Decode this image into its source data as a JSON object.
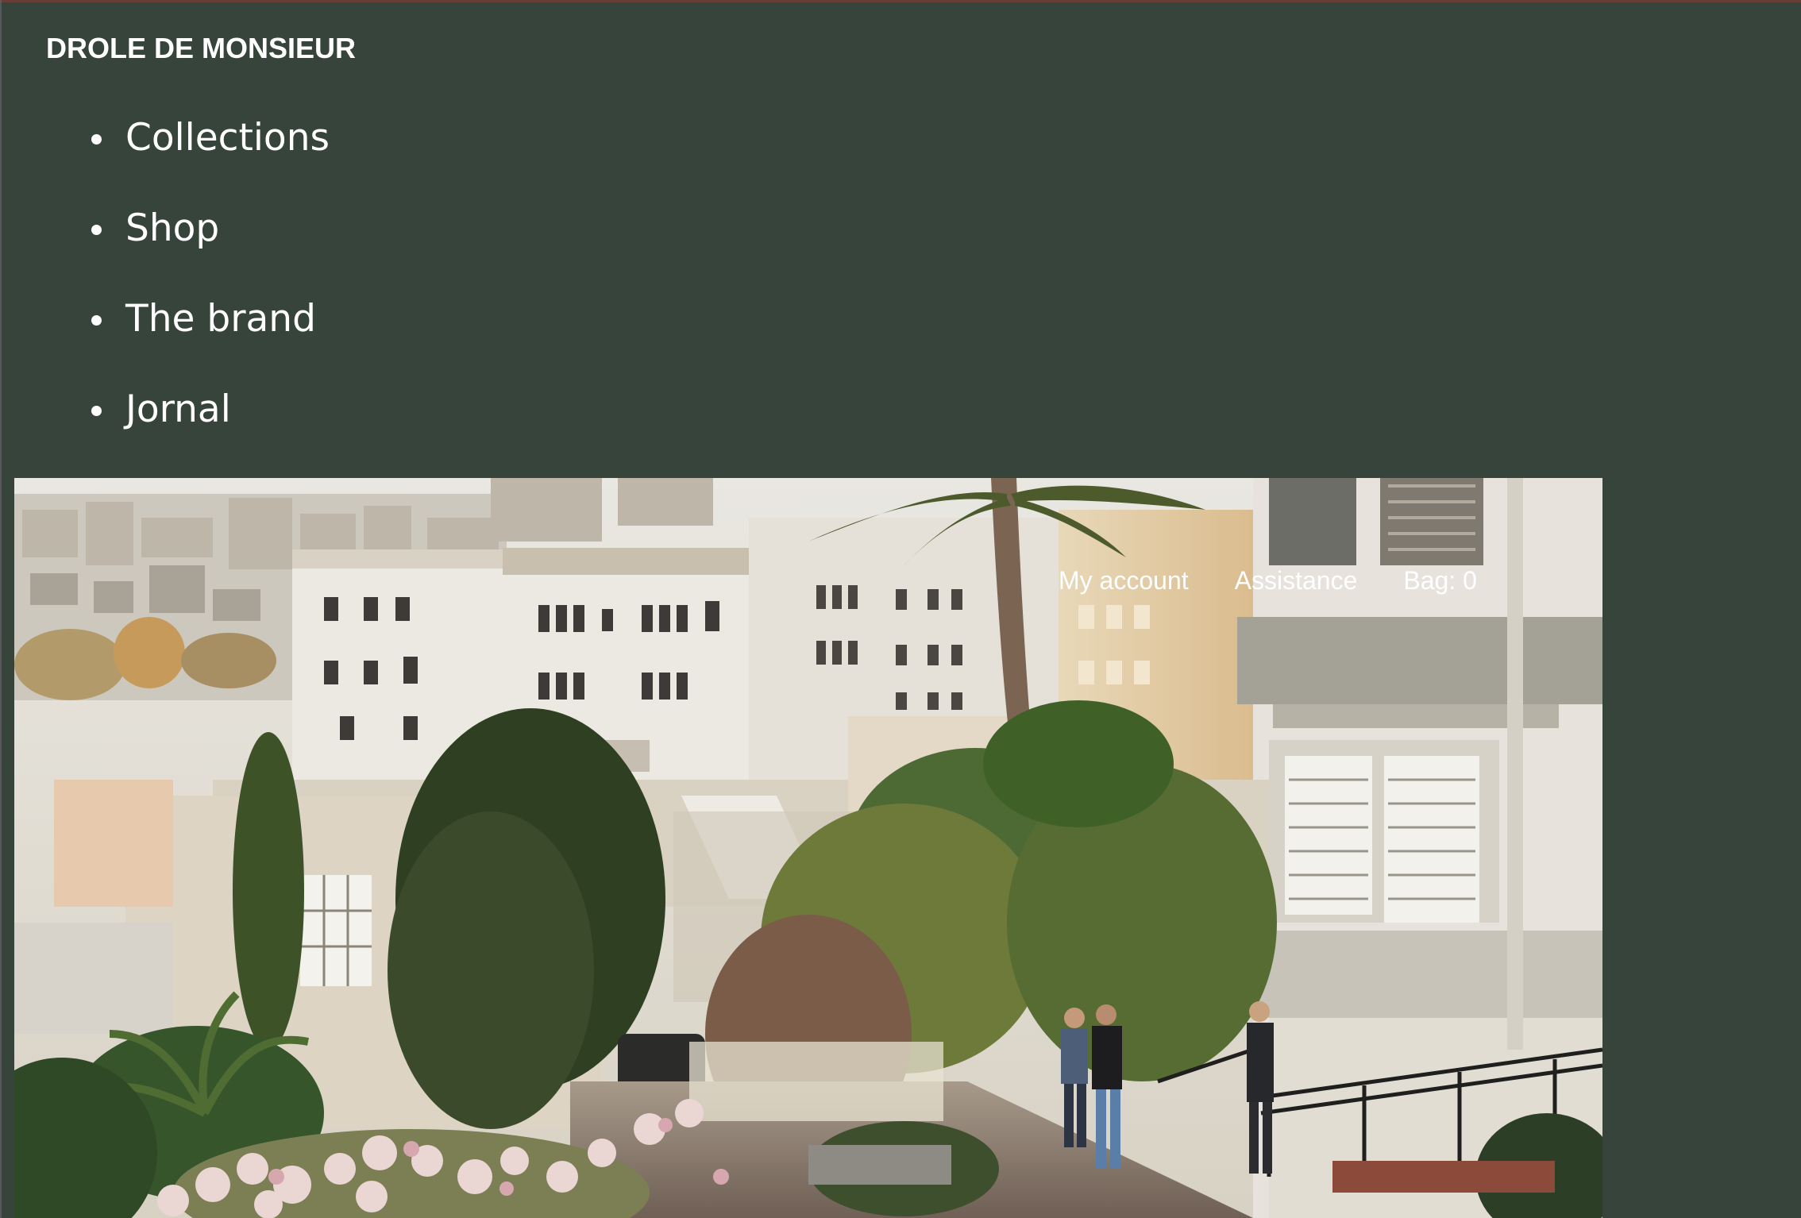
{
  "header": {
    "brand": "DROLE DE MONSIEUR"
  },
  "nav": {
    "items": [
      {
        "label": "Collections"
      },
      {
        "label": "Shop"
      },
      {
        "label": "The brand"
      },
      {
        "label": "Jornal"
      }
    ]
  },
  "utility": {
    "account_label": "My account",
    "assistance_label": "Assistance",
    "bag_label": "Bag: 0"
  },
  "theme": {
    "background": "#37443b",
    "text": "#ffffff"
  }
}
